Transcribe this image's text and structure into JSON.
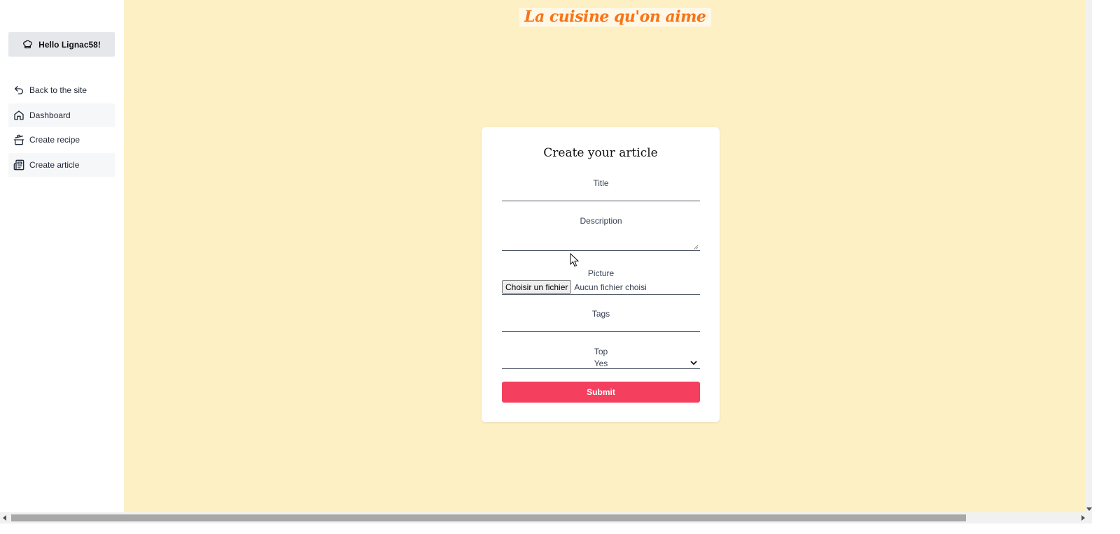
{
  "sidebar": {
    "greeting": "Hello Lignac58!",
    "greeting_icon": "chef-hat-icon",
    "items": [
      {
        "label": "Back to the site",
        "icon": "back-arrow-icon"
      },
      {
        "label": "Dashboard",
        "icon": "home-icon"
      },
      {
        "label": "Create recipe",
        "icon": "cooking-pot-icon"
      },
      {
        "label": "Create article",
        "icon": "newspaper-icon"
      }
    ]
  },
  "header": {
    "brand": "La cuisine qu'on aime"
  },
  "form": {
    "title": "Create your article",
    "title_label": "Title",
    "title_value": "",
    "description_label": "Description",
    "description_value": "",
    "picture_label": "Picture",
    "file_button": "Choisir un fichier",
    "file_status": "Aucun fichier choisi",
    "tags_label": "Tags",
    "tags_value": "",
    "top_label": "Top",
    "top_value": "Yes",
    "submit_label": "Submit"
  },
  "colors": {
    "background": "#fdf0c5",
    "brand": "#f97316",
    "submit": "#f43f5e",
    "greeting_bg": "#e5e7eb"
  }
}
